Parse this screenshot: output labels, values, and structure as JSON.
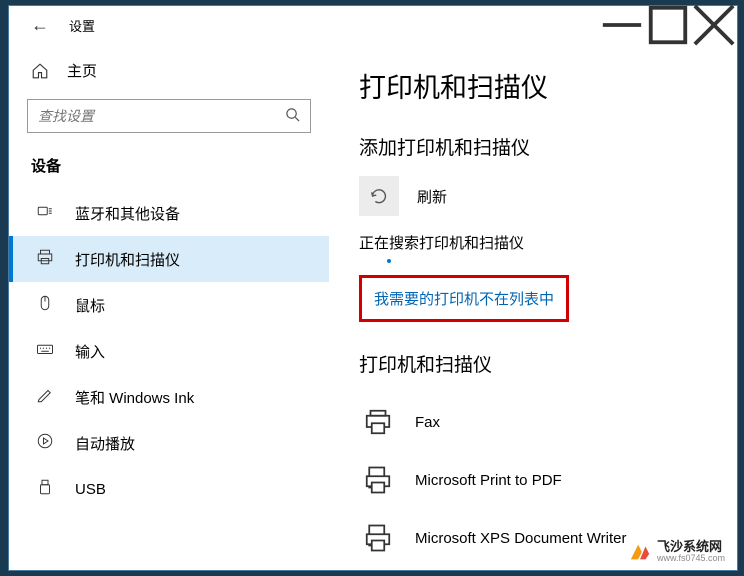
{
  "window": {
    "title": "设置",
    "back": "←"
  },
  "home": {
    "label": "主页"
  },
  "search": {
    "placeholder": "查找设置"
  },
  "section_title": "设备",
  "nav": {
    "items": [
      {
        "label": "蓝牙和其他设备"
      },
      {
        "label": "打印机和扫描仪"
      },
      {
        "label": "鼠标"
      },
      {
        "label": "输入"
      },
      {
        "label": "笔和 Windows Ink"
      },
      {
        "label": "自动播放"
      },
      {
        "label": "USB"
      }
    ]
  },
  "main": {
    "title": "打印机和扫描仪",
    "add_section": "添加打印机和扫描仪",
    "refresh": "刷新",
    "searching": "正在搜索打印机和扫描仪",
    "not_in_list": "我需要的打印机不在列表中",
    "list_section": "打印机和扫描仪",
    "printers": [
      {
        "label": "Fax"
      },
      {
        "label": "Microsoft Print to PDF"
      },
      {
        "label": "Microsoft XPS Document Writer"
      }
    ]
  },
  "watermark": {
    "name": "飞沙系统网",
    "url": "www.fs0745.com"
  }
}
